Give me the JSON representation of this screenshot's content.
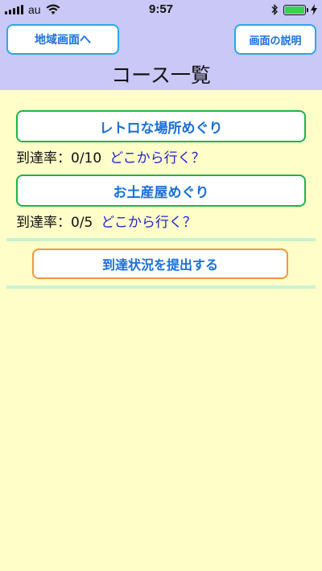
{
  "status_bar": {
    "carrier": "au",
    "time": "9:57",
    "battery_level": 1.0
  },
  "header": {
    "left_button": "地域画面へ",
    "right_button": "画面の説明",
    "title": "コース一覧"
  },
  "courses": [
    {
      "button": "レトロな場所めぐり",
      "progress_label": "到達率：0/10",
      "link": "どこから行く？"
    },
    {
      "button": "お土産屋めぐり",
      "progress_label": "到達率：0/5",
      "link": "どこから行く？"
    }
  ],
  "submit_button": "到達状況を提出する",
  "colors": {
    "header_bg": "#c9c8f6",
    "body_bg": "#fffdc8",
    "course_border": "#21b24d",
    "submit_border": "#f0973c",
    "link": "#2226c9"
  }
}
